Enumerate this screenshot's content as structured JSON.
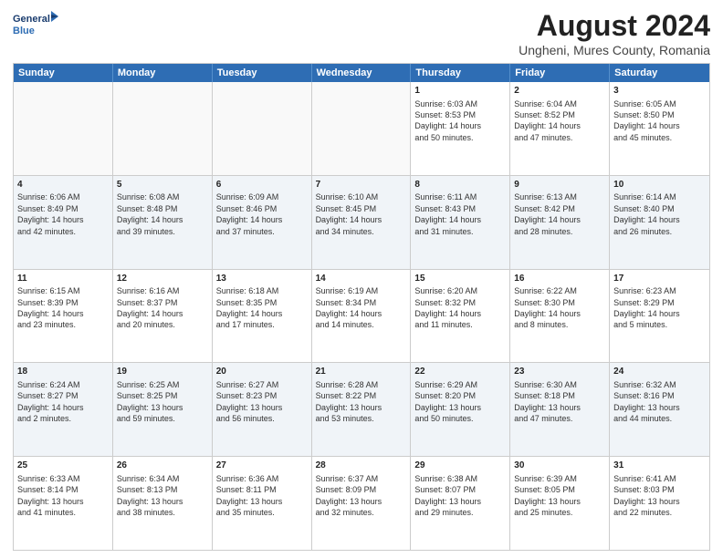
{
  "header": {
    "logo_line1": "General",
    "logo_line2": "Blue",
    "title": "August 2024",
    "subtitle": "Ungheni, Mures County, Romania"
  },
  "days": [
    "Sunday",
    "Monday",
    "Tuesday",
    "Wednesday",
    "Thursday",
    "Friday",
    "Saturday"
  ],
  "weeks": [
    [
      {
        "day": "",
        "info": ""
      },
      {
        "day": "",
        "info": ""
      },
      {
        "day": "",
        "info": ""
      },
      {
        "day": "",
        "info": ""
      },
      {
        "day": "1",
        "info": "Sunrise: 6:03 AM\nSunset: 8:53 PM\nDaylight: 14 hours\nand 50 minutes."
      },
      {
        "day": "2",
        "info": "Sunrise: 6:04 AM\nSunset: 8:52 PM\nDaylight: 14 hours\nand 47 minutes."
      },
      {
        "day": "3",
        "info": "Sunrise: 6:05 AM\nSunset: 8:50 PM\nDaylight: 14 hours\nand 45 minutes."
      }
    ],
    [
      {
        "day": "4",
        "info": "Sunrise: 6:06 AM\nSunset: 8:49 PM\nDaylight: 14 hours\nand 42 minutes."
      },
      {
        "day": "5",
        "info": "Sunrise: 6:08 AM\nSunset: 8:48 PM\nDaylight: 14 hours\nand 39 minutes."
      },
      {
        "day": "6",
        "info": "Sunrise: 6:09 AM\nSunset: 8:46 PM\nDaylight: 14 hours\nand 37 minutes."
      },
      {
        "day": "7",
        "info": "Sunrise: 6:10 AM\nSunset: 8:45 PM\nDaylight: 14 hours\nand 34 minutes."
      },
      {
        "day": "8",
        "info": "Sunrise: 6:11 AM\nSunset: 8:43 PM\nDaylight: 14 hours\nand 31 minutes."
      },
      {
        "day": "9",
        "info": "Sunrise: 6:13 AM\nSunset: 8:42 PM\nDaylight: 14 hours\nand 28 minutes."
      },
      {
        "day": "10",
        "info": "Sunrise: 6:14 AM\nSunset: 8:40 PM\nDaylight: 14 hours\nand 26 minutes."
      }
    ],
    [
      {
        "day": "11",
        "info": "Sunrise: 6:15 AM\nSunset: 8:39 PM\nDaylight: 14 hours\nand 23 minutes."
      },
      {
        "day": "12",
        "info": "Sunrise: 6:16 AM\nSunset: 8:37 PM\nDaylight: 14 hours\nand 20 minutes."
      },
      {
        "day": "13",
        "info": "Sunrise: 6:18 AM\nSunset: 8:35 PM\nDaylight: 14 hours\nand 17 minutes."
      },
      {
        "day": "14",
        "info": "Sunrise: 6:19 AM\nSunset: 8:34 PM\nDaylight: 14 hours\nand 14 minutes."
      },
      {
        "day": "15",
        "info": "Sunrise: 6:20 AM\nSunset: 8:32 PM\nDaylight: 14 hours\nand 11 minutes."
      },
      {
        "day": "16",
        "info": "Sunrise: 6:22 AM\nSunset: 8:30 PM\nDaylight: 14 hours\nand 8 minutes."
      },
      {
        "day": "17",
        "info": "Sunrise: 6:23 AM\nSunset: 8:29 PM\nDaylight: 14 hours\nand 5 minutes."
      }
    ],
    [
      {
        "day": "18",
        "info": "Sunrise: 6:24 AM\nSunset: 8:27 PM\nDaylight: 14 hours\nand 2 minutes."
      },
      {
        "day": "19",
        "info": "Sunrise: 6:25 AM\nSunset: 8:25 PM\nDaylight: 13 hours\nand 59 minutes."
      },
      {
        "day": "20",
        "info": "Sunrise: 6:27 AM\nSunset: 8:23 PM\nDaylight: 13 hours\nand 56 minutes."
      },
      {
        "day": "21",
        "info": "Sunrise: 6:28 AM\nSunset: 8:22 PM\nDaylight: 13 hours\nand 53 minutes."
      },
      {
        "day": "22",
        "info": "Sunrise: 6:29 AM\nSunset: 8:20 PM\nDaylight: 13 hours\nand 50 minutes."
      },
      {
        "day": "23",
        "info": "Sunrise: 6:30 AM\nSunset: 8:18 PM\nDaylight: 13 hours\nand 47 minutes."
      },
      {
        "day": "24",
        "info": "Sunrise: 6:32 AM\nSunset: 8:16 PM\nDaylight: 13 hours\nand 44 minutes."
      }
    ],
    [
      {
        "day": "25",
        "info": "Sunrise: 6:33 AM\nSunset: 8:14 PM\nDaylight: 13 hours\nand 41 minutes."
      },
      {
        "day": "26",
        "info": "Sunrise: 6:34 AM\nSunset: 8:13 PM\nDaylight: 13 hours\nand 38 minutes."
      },
      {
        "day": "27",
        "info": "Sunrise: 6:36 AM\nSunset: 8:11 PM\nDaylight: 13 hours\nand 35 minutes."
      },
      {
        "day": "28",
        "info": "Sunrise: 6:37 AM\nSunset: 8:09 PM\nDaylight: 13 hours\nand 32 minutes."
      },
      {
        "day": "29",
        "info": "Sunrise: 6:38 AM\nSunset: 8:07 PM\nDaylight: 13 hours\nand 29 minutes."
      },
      {
        "day": "30",
        "info": "Sunrise: 6:39 AM\nSunset: 8:05 PM\nDaylight: 13 hours\nand 25 minutes."
      },
      {
        "day": "31",
        "info": "Sunrise: 6:41 AM\nSunset: 8:03 PM\nDaylight: 13 hours\nand 22 minutes."
      }
    ]
  ]
}
